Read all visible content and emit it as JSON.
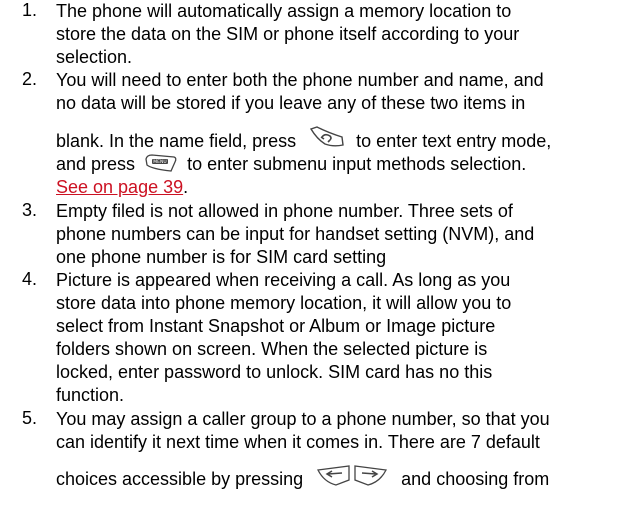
{
  "items": [
    {
      "number": "1.",
      "lines": [
        "The phone will automatically assign a memory location to",
        "store the data on the SIM or phone itself according to your",
        "selection."
      ]
    },
    {
      "number": "2.",
      "lines": [
        "You will need to enter both the phone number and name, and",
        "no data will be stored if you leave any of these two items in"
      ],
      "line3_a": "blank. In the name field, press",
      "line3_b": "to enter text entry mode,",
      "line4_a": "and press",
      "line4_b": "to enter submenu input methods selection.",
      "link_text": "See on page 39",
      "link_after": "."
    },
    {
      "number": "3.",
      "lines": [
        "Empty filed is not allowed in phone number.   Three sets of",
        "phone numbers can be input for handset setting (NVM), and",
        "one phone number is for SIM card setting"
      ]
    },
    {
      "number": "4.",
      "lines": [
        "Picture is appeared when receiving a call. As long as you",
        "store data into phone memory location, it will allow you to",
        "select from Instant Snapshot or Album or Image picture",
        "folders shown on screen.   When the selected picture is",
        "locked, enter password to unlock.   SIM card has no this",
        "function."
      ]
    },
    {
      "number": "5.",
      "lines": [
        "You may assign a caller group to a phone number, so that you",
        "can identify it next time when it comes in. There are 7 default"
      ],
      "line3_a": "choices accessible by pressing",
      "line3_b": "and choosing from"
    }
  ],
  "icons": {
    "send_key": "send-key-icon",
    "menu_key": "menu-key-icon",
    "left_nav": "left-nav-key-icon",
    "right_nav": "right-nav-key-icon"
  }
}
